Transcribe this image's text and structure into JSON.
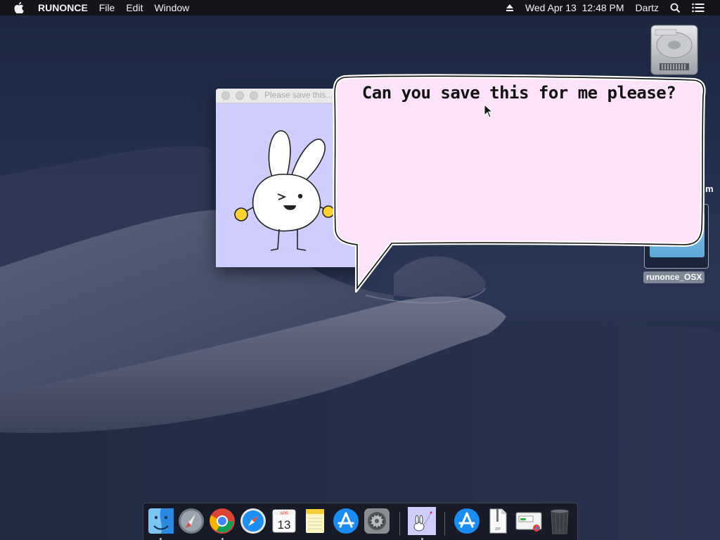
{
  "menubar": {
    "apple_icon": "apple-logo-icon",
    "app_name": "RUNONCE",
    "menus": [
      "File",
      "Edit",
      "Window"
    ],
    "eject_icon": "eject-icon",
    "clock": "Wed Apr 13  12:48 PM",
    "user": "Dartz",
    "search_icon": "spotlight-search-icon",
    "notification_icon": "notification-center-icon"
  },
  "desktop": {
    "drive_icon": "hard-drive-icon",
    "file_label": "runonce_OSX",
    "edge_fragment": "m"
  },
  "app_window": {
    "title": "Please save this..."
  },
  "bubble": {
    "text": "Can you save this for me please?"
  },
  "dock": {
    "items": [
      {
        "name": "Finder",
        "icon": "finder-icon"
      },
      {
        "name": "Launchpad",
        "icon": "launchpad-icon"
      },
      {
        "name": "Google Chrome",
        "icon": "chrome-icon"
      },
      {
        "name": "Safari",
        "icon": "safari-icon"
      },
      {
        "name": "Calendar",
        "icon": "calendar-icon",
        "month": "APR",
        "day": "13"
      },
      {
        "name": "Notes",
        "icon": "notes-icon"
      },
      {
        "name": "App Store",
        "icon": "app-store-icon"
      },
      {
        "name": "System Preferences",
        "icon": "system-preferences-icon"
      },
      {
        "name": "RUNONCE",
        "icon": "runonce-bunny-icon"
      },
      {
        "name": "App Store folder",
        "icon": "app-store-folder-icon"
      },
      {
        "name": "Archive",
        "icon": "zip-archive-icon",
        "label": "ZIP"
      },
      {
        "name": "Installer",
        "icon": "installer-screen-icon"
      },
      {
        "name": "Trash",
        "icon": "trash-icon"
      }
    ]
  },
  "colors": {
    "window_bg": "#cfcdfd",
    "bubble_fill": "#fde2fb",
    "menubar_bg": "#141418"
  }
}
